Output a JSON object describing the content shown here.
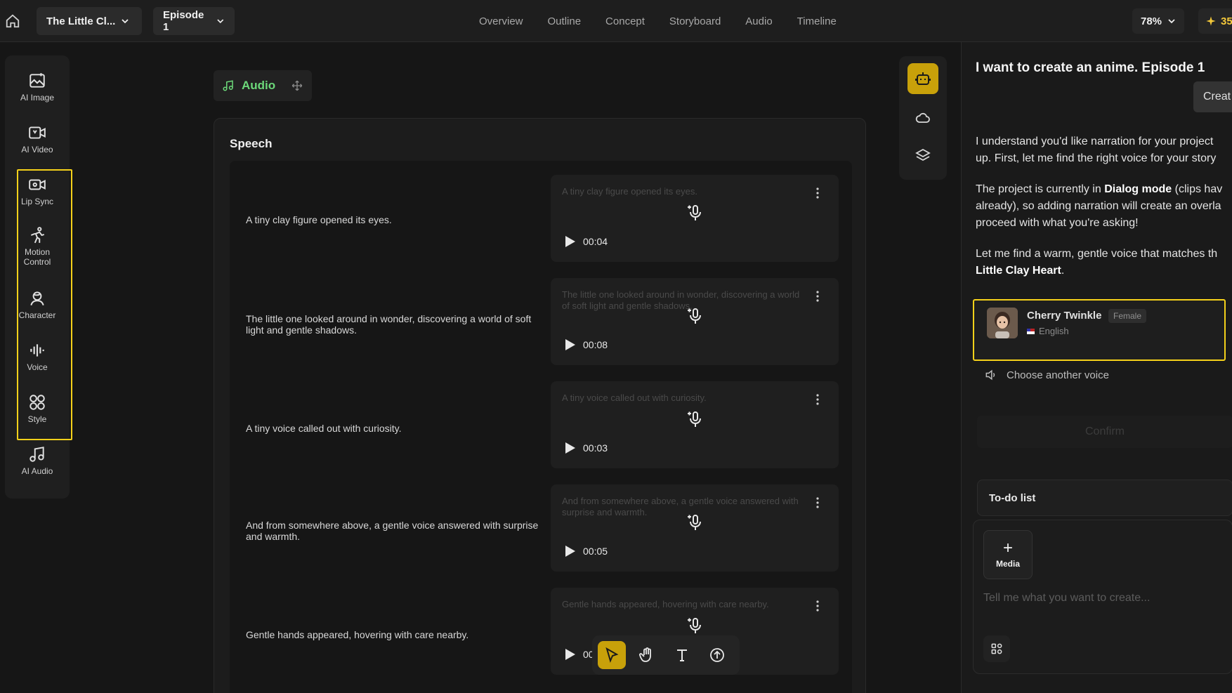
{
  "topbar": {
    "project_title": "The Little Cl...",
    "episode": "Episode 1",
    "nav": [
      "Overview",
      "Outline",
      "Concept",
      "Storyboard",
      "Audio",
      "Timeline"
    ],
    "zoom": "78%",
    "credits": "35"
  },
  "tools": [
    {
      "label": "AI Image",
      "icon": "ai-image-icon"
    },
    {
      "label": "AI Video",
      "icon": "ai-video-icon"
    },
    {
      "label": "Lip Sync",
      "icon": "lip-sync-icon"
    },
    {
      "label": "Motion Control",
      "icon": "motion-control-icon"
    },
    {
      "label": "Character",
      "icon": "character-icon"
    },
    {
      "label": "Voice",
      "icon": "voice-icon"
    },
    {
      "label": "Style",
      "icon": "style-icon"
    },
    {
      "label": "AI Audio",
      "icon": "ai-audio-icon"
    }
  ],
  "audio_chip": {
    "label": "Audio"
  },
  "speech": {
    "title": "Speech",
    "rows": [
      {
        "text": "A tiny clay figure opened its eyes.",
        "ghost": "A tiny clay figure opened its eyes.",
        "duration": "00:04"
      },
      {
        "text": "The little one looked around in wonder, discovering a world of soft light and gentle shadows.",
        "ghost": "The little one looked around in wonder, discovering a world of soft light and gentle shadows.",
        "duration": "00:08"
      },
      {
        "text": "A tiny voice called out with curiosity.",
        "ghost": "A tiny voice called out with curiosity.",
        "duration": "00:03"
      },
      {
        "text": "And from somewhere above, a gentle voice answered with surprise and warmth.",
        "ghost": "And from somewhere above, a gentle voice answered with surprise and warmth.",
        "duration": "00:05"
      },
      {
        "text": "Gentle hands appeared, hovering with care nearby.",
        "ghost": "Gentle hands appeared, hovering with care nearby.",
        "duration": "00"
      }
    ]
  },
  "chat": {
    "title": "I want to create an anime. Episode 1",
    "create_label": "Creat",
    "p1": [
      "I understand you'd like narration for your project",
      "up. First, let me find the right voice for your story"
    ],
    "p2_pre": "The project is currently in ",
    "p2_bold": "Dialog mode",
    "p2_post": " (clips hav",
    "p2_l2": "already), so adding narration will create an overla",
    "p2_l3": "proceed with what you're asking!",
    "p3_l1": "Let me find a warm, gentle voice that matches th",
    "p3_bold": "Little Clay Heart",
    "p3_end": ".",
    "voice_card": {
      "name": "Cherry Twinkle",
      "gender": "Female",
      "language": "English"
    },
    "choose_voice": "Choose another voice",
    "confirm": "Confirm",
    "todo": "To-do list",
    "media_label": "Media",
    "input_placeholder": "Tell me what you want to create..."
  }
}
